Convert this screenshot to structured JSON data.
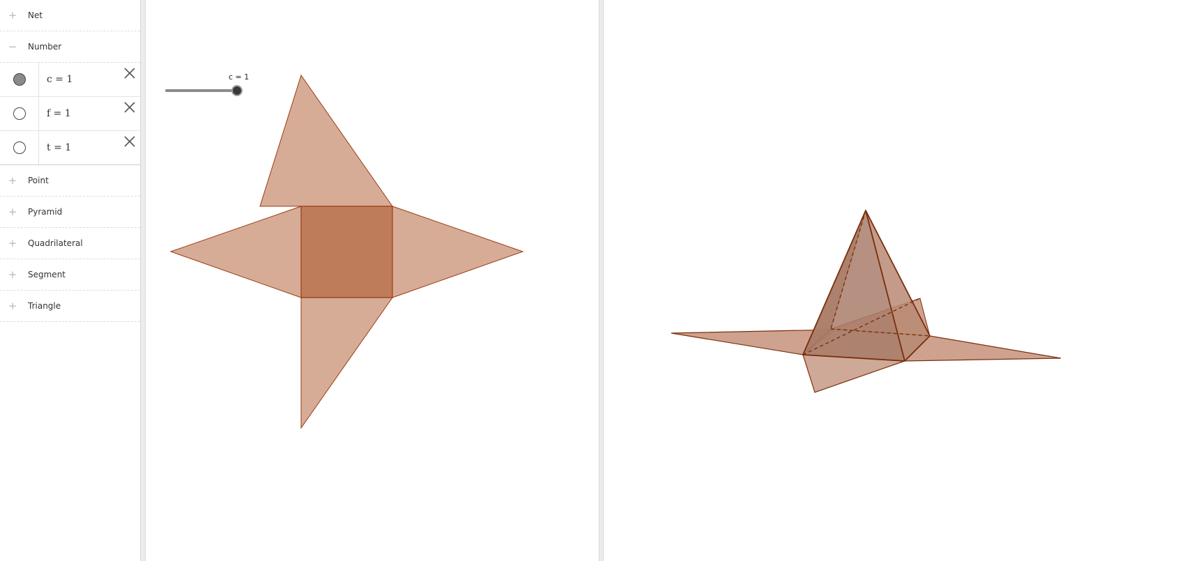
{
  "algebra_view": {
    "groups_top": [
      {
        "label": "Net",
        "toggle": "+"
      },
      {
        "label": "Number",
        "toggle": "−"
      }
    ],
    "number_items": [
      {
        "text": "c = 1",
        "visible": true
      },
      {
        "text": "f = 1",
        "visible": false
      },
      {
        "text": "t = 1",
        "visible": false
      }
    ],
    "groups_bottom": [
      {
        "label": "Point",
        "toggle": "+"
      },
      {
        "label": "Pyramid",
        "toggle": "+"
      },
      {
        "label": "Quadrilateral",
        "toggle": "+"
      },
      {
        "label": "Segment",
        "toggle": "+"
      },
      {
        "label": "Triangle",
        "toggle": "+"
      }
    ]
  },
  "graphics_2d": {
    "slider": {
      "label": "c = 1",
      "value": 1,
      "min": 0,
      "max": 1
    }
  },
  "colors": {
    "face_light": "#d6ac97",
    "face_dark": "#bf7c5b",
    "edge": "#9a3a10",
    "edge_3d": "#7a2e0c",
    "face_3d_a": "#c99882",
    "face_3d_b": "#a97d6a",
    "face_3d_c": "#b98a73"
  },
  "icons": {
    "expand": "plus-icon",
    "collapse": "minus-icon",
    "delete": "close-x-icon",
    "visibility": "visibility-marble-icon"
  }
}
